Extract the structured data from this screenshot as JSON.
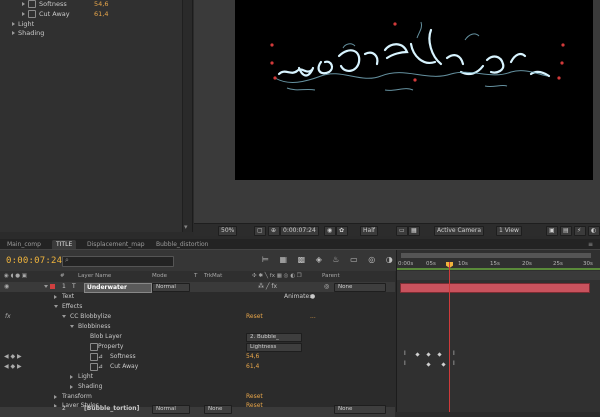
{
  "effect_controls": {
    "rows": [
      {
        "label": "Softness",
        "value": "54,6"
      },
      {
        "label": "Cut Away",
        "value": "61,4"
      },
      {
        "label": "Light"
      },
      {
        "label": "Shading"
      }
    ]
  },
  "viewer": {
    "zoom": "50%",
    "timecode": "0:00:07:24",
    "resolution": "Half",
    "camera": "Active Camera",
    "view": "1 View"
  },
  "tabs": [
    {
      "label": "Main_comp",
      "active": false
    },
    {
      "label": "TITLE",
      "active": true
    },
    {
      "label": "Displacement_map",
      "active": false
    },
    {
      "label": "Bubble_distortion",
      "active": false
    }
  ],
  "timeline": {
    "timecode": "0:00:07:24",
    "search_placeholder": "",
    "columns": {
      "hash": "#",
      "layer_name": "Layer Name",
      "mode": "Mode",
      "t": "T",
      "trkmat": "TrkMat",
      "parent": "Parent"
    },
    "ruler": [
      "0:00s",
      "05s",
      "10s",
      "15s",
      "20s",
      "25s",
      "30s"
    ],
    "layer1": {
      "number": "1",
      "name": "Underwater",
      "mode": "Normal",
      "parent": "None"
    },
    "rows": {
      "text": "Text",
      "animate": "Animate:",
      "effects": "Effects",
      "blobbylize": "CC Blobbylize",
      "reset1": "Reset",
      "dots": "...",
      "blobbiness": "Blobbiness",
      "blob_layer": "Blob Layer",
      "blob_layer_value": "2. Bubble_",
      "property": "Property",
      "property_value": "Lightness",
      "softness": "Softness",
      "softness_value": "54,6",
      "cutaway": "Cut Away",
      "cutaway_value": "61,4",
      "light": "Light",
      "shading": "Shading",
      "transform": "Transform",
      "reset2": "Reset",
      "layer_styles": "Layer Styles",
      "reset3": "Reset",
      "layer2_number": "2",
      "layer2_name": "[Bubble_tortion]",
      "layer2_mode": "Normal",
      "layer2_trkmat": "None",
      "layer2_parent": "None"
    }
  },
  "colors": {
    "accent": "#f0b43c",
    "bar": "#c9525d",
    "playhead": "#d03a3a"
  }
}
